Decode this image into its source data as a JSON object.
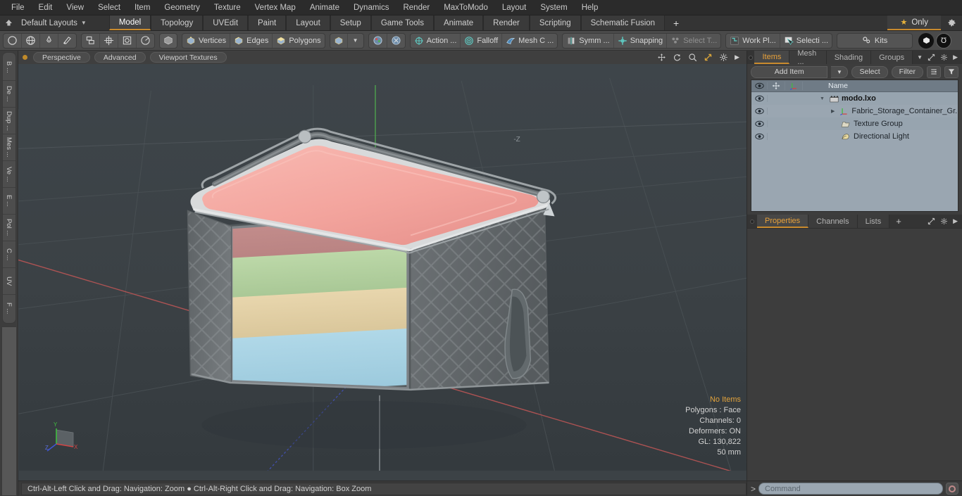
{
  "menubar": {
    "items": [
      "File",
      "Edit",
      "View",
      "Select",
      "Item",
      "Geometry",
      "Texture",
      "Vertex Map",
      "Animate",
      "Dynamics",
      "Render",
      "MaxToModo",
      "Layout",
      "System",
      "Help"
    ]
  },
  "layoutbar": {
    "home_icon": "home-icon",
    "preset_label": "Default Layouts",
    "tabs": [
      {
        "label": "Model",
        "active": true
      },
      {
        "label": "Topology",
        "active": false
      },
      {
        "label": "UVEdit",
        "active": false
      },
      {
        "label": "Paint",
        "active": false
      },
      {
        "label": "Layout",
        "active": false
      },
      {
        "label": "Setup",
        "active": false
      },
      {
        "label": "Game Tools",
        "active": false
      },
      {
        "label": "Animate",
        "active": false
      },
      {
        "label": "Render",
        "active": false
      },
      {
        "label": "Scripting",
        "active": false
      },
      {
        "label": "Schematic Fusion",
        "active": false
      }
    ],
    "add_tab_label": "+",
    "only_label": "Only",
    "star_glyph": "★",
    "gear_glyph": "✲",
    "accent_color": "#c98b2e"
  },
  "toolbar": {
    "group1": [
      {
        "name": "circle-tool-icon",
        "label": ""
      },
      {
        "name": "globe-tool-icon",
        "label": ""
      },
      {
        "name": "pen-tool-icon",
        "label": ""
      },
      {
        "name": "paint-tool-icon",
        "label": ""
      }
    ],
    "group2": [
      {
        "name": "duplicate-icon",
        "label": ""
      },
      {
        "name": "center-icon",
        "label": ""
      },
      {
        "name": "square-inset-icon",
        "label": ""
      },
      {
        "name": "radial-icon",
        "label": ""
      }
    ],
    "group3": [
      {
        "name": "item-mode-icon",
        "label": ""
      },
      {
        "name": "vertices-icon",
        "label": "Vertices"
      },
      {
        "name": "edges-icon",
        "label": "Edges"
      },
      {
        "name": "polygons-icon",
        "label": "Polygons"
      },
      {
        "name": "mode-cube-icon",
        "label": ""
      },
      {
        "name": "mode-caret-icon",
        "label": ""
      }
    ],
    "group4": [
      {
        "name": "center-sphere-icon",
        "label": ""
      },
      {
        "name": "pivot-icon",
        "label": ""
      }
    ],
    "group5": [
      {
        "name": "action-center-icon",
        "label": "Action  ..."
      },
      {
        "name": "falloff-icon",
        "label": "Falloff"
      },
      {
        "name": "mesh-constraint-icon",
        "label": "Mesh C ..."
      }
    ],
    "group6": [
      {
        "name": "symmetry-icon",
        "label": "Symm ..."
      },
      {
        "name": "snapping-icon",
        "label": "Snapping"
      },
      {
        "name": "select-through-icon",
        "label": "Select T...",
        "dim": true
      }
    ],
    "group7": [
      {
        "name": "work-plane-icon",
        "label": "Work Pl..."
      },
      {
        "name": "selection-set-icon",
        "label": "Selecti ..."
      }
    ],
    "group8": [
      {
        "name": "kits-icon",
        "label": "Kits"
      }
    ],
    "group9": [
      {
        "name": "modo-logo-icon",
        "label": ""
      },
      {
        "name": "unreal-logo-icon",
        "label": ""
      }
    ]
  },
  "vstrip": {
    "tabs": [
      {
        "label": "B ...",
        "name": "sidebar-tab-basic"
      },
      {
        "label": "De ...",
        "name": "sidebar-tab-deform"
      },
      {
        "label": "Dup ...",
        "name": "sidebar-tab-duplicate"
      },
      {
        "label": "Mes ...",
        "name": "sidebar-tab-mesh"
      },
      {
        "label": "Ve ...",
        "name": "sidebar-tab-vertex"
      },
      {
        "label": "E ...",
        "name": "sidebar-tab-edge"
      },
      {
        "label": "Pol ...",
        "name": "sidebar-tab-polygon"
      },
      {
        "label": "C ...",
        "name": "sidebar-tab-curve"
      },
      {
        "label": "UV",
        "name": "sidebar-tab-uv"
      },
      {
        "label": "F ...",
        "name": "sidebar-tab-falloff"
      }
    ]
  },
  "viewport": {
    "header": {
      "view_mode": "Perspective",
      "shading_mode": "Advanced",
      "texture_mode": "Viewport Textures",
      "icons": [
        "pan-icon",
        "rotate-icon",
        "zoom-icon",
        "fit-icon",
        "viewport-gear-icon",
        "viewport-more-icon"
      ]
    },
    "stats": {
      "items": "No Items",
      "polygons": "Polygons : Face",
      "channels": "Channels: 0",
      "deformers": "Deformers: ON",
      "gl": "GL: 130,822",
      "scale": "50 mm"
    },
    "gizmo": {
      "x_label": "X",
      "y_label": "Y",
      "z_label": "Z",
      "x_color": "#d04040",
      "y_color": "#40c040",
      "z_color": "#4060e0"
    },
    "axis_label_z": "-Z",
    "model": {
      "name": "fabric-storage-container",
      "lid_color": "#f4a9a3",
      "body_color": "#6d7274",
      "trim_color": "#d9d9d9",
      "contents": [
        {
          "label": "layer-rose",
          "color": "#c9908f"
        },
        {
          "label": "layer-green",
          "color": "#b4d3a0"
        },
        {
          "label": "layer-tan",
          "color": "#e3d1a8"
        },
        {
          "label": "layer-blue",
          "color": "#a8d2e3"
        }
      ]
    }
  },
  "statusbar": {
    "text": "Ctrl-Alt-Left Click and Drag: Navigation: Zoom ● Ctrl-Alt-Right Click and Drag: Navigation: Box Zoom"
  },
  "rpanel": {
    "top_tabs": [
      {
        "label": "Items",
        "active": true
      },
      {
        "label": "Mesh ...",
        "active": false
      },
      {
        "label": "Shading",
        "active": false
      },
      {
        "label": "Groups",
        "active": false
      }
    ],
    "controls": {
      "add_item": "Add Item",
      "add_item_caret": "▼",
      "select": "Select",
      "filter": "Filter",
      "sort_icon": "sort-icon",
      "funnel_icon": "funnel-icon"
    },
    "tree_headers": {
      "eye": "eye-icon",
      "col_a": "move-icon",
      "col_b": "axis-icon",
      "name": "Name"
    },
    "tree": [
      {
        "name": "modo.lxo",
        "icon": "scene-clapper-icon",
        "indent": 0,
        "bold": true,
        "expander": "▼"
      },
      {
        "name": "Fabric_Storage_Container_Gr...",
        "icon": "locator-axis-icon",
        "indent": 1,
        "bold": false,
        "expander": "▶"
      },
      {
        "name": "Texture Group",
        "icon": "folder-icon",
        "indent": 1,
        "bold": false,
        "expander": ""
      },
      {
        "name": "Directional Light",
        "icon": "light-icon",
        "indent": 1,
        "bold": false,
        "expander": ""
      }
    ],
    "bottom_tabs": [
      {
        "label": "Properties",
        "active": true
      },
      {
        "label": "Channels",
        "active": false
      },
      {
        "label": "Lists",
        "active": false
      }
    ],
    "bottom_add_label": "+"
  },
  "command": {
    "prompt": ">",
    "placeholder": "Command",
    "record_icon": "record-icon"
  }
}
